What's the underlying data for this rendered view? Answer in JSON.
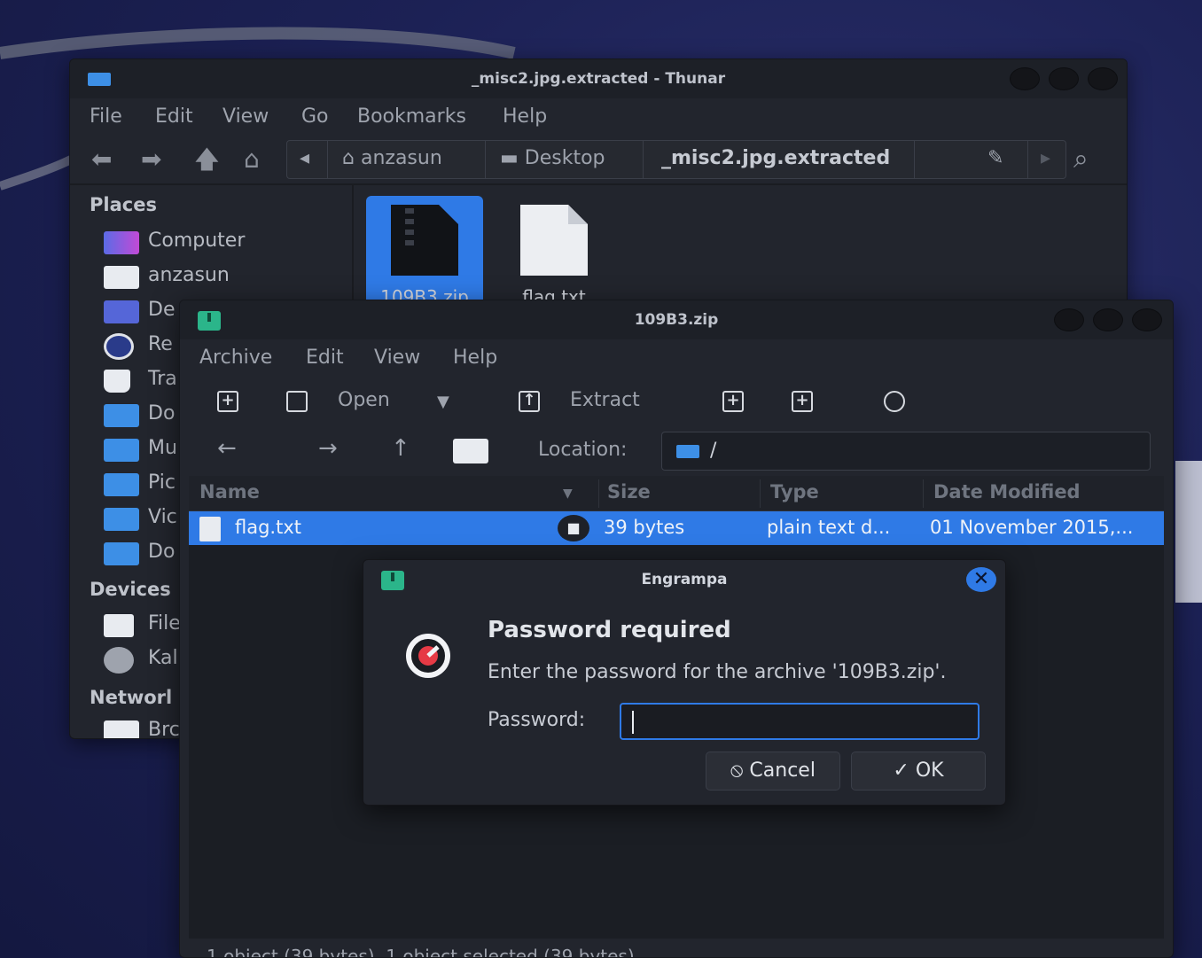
{
  "thunar": {
    "title": "_misc2.jpg.extracted - Thunar",
    "menu": [
      "File",
      "Edit",
      "View",
      "Go",
      "Bookmarks",
      "Help"
    ],
    "path": [
      "anzasun",
      "Desktop",
      "_misc2.jpg.extracted"
    ],
    "sidebar": {
      "places_label": "Places",
      "places": [
        "Computer",
        "anzasun",
        "De",
        "Re",
        "Tra",
        "Do",
        "Mu",
        "Pic",
        "Vic",
        "Do"
      ],
      "devices_label": "Devices",
      "devices": [
        "File",
        "Kal"
      ],
      "network_label": "Networl",
      "network": [
        "Brc"
      ]
    },
    "files": [
      "109B3.zip",
      "flag.txt"
    ]
  },
  "engrampa": {
    "title": "109B3.zip",
    "menu": [
      "Archive",
      "Edit",
      "View",
      "Help"
    ],
    "toolbar": {
      "open": "Open",
      "extract": "Extract"
    },
    "location_label": "Location:",
    "location_value": "/",
    "columns": {
      "name": "Name",
      "size": "Size",
      "type": "Type",
      "date": "Date Modified"
    },
    "rows": [
      {
        "name": "flag.txt",
        "size": "39 bytes",
        "type": "plain text d...",
        "date": "01 November 2015,..."
      }
    ],
    "status": "1 object (39 bytes), 1 object selected (39 bytes)"
  },
  "dialog": {
    "title": "Engrampa",
    "heading": "Password required",
    "message": "Enter the password for the archive '109B3.zip'.",
    "password_label": "Password:",
    "password_value": "",
    "cancel": "Cancel",
    "ok": "OK"
  },
  "colors": {
    "accent": "#2f7ae6",
    "window_bg": "#22252d",
    "archive_icon": "#2bb58a"
  }
}
